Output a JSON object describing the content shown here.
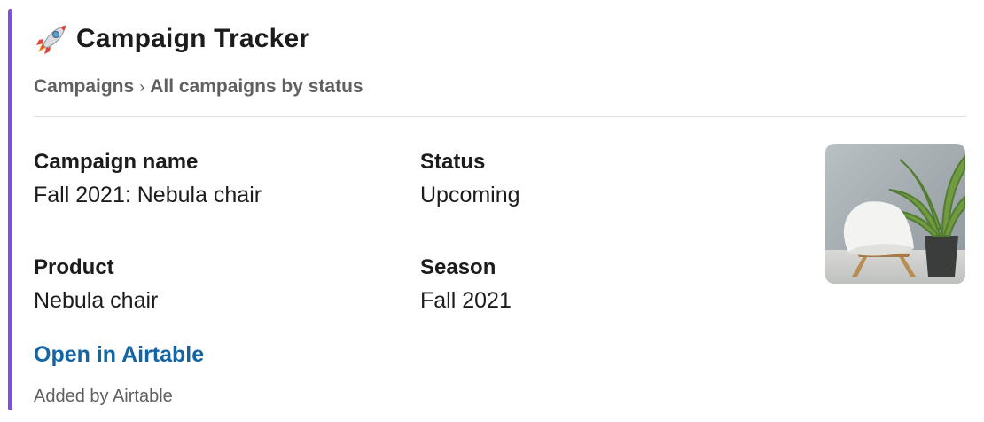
{
  "card": {
    "accent_color": "#7b4fe0",
    "icon": "rocket-icon",
    "title": "Campaign Tracker",
    "breadcrumb": {
      "parent": "Campaigns",
      "separator": "›",
      "current": "All campaigns by status"
    },
    "fields": {
      "campaign_name": {
        "label": "Campaign name",
        "value": "Fall 2021: Nebula chair"
      },
      "status": {
        "label": "Status",
        "value": "Upcoming"
      },
      "product": {
        "label": "Product",
        "value": "Nebula chair"
      },
      "season": {
        "label": "Season",
        "value": "Fall 2021"
      }
    },
    "thumbnail_icon": "chair-with-plant-photo",
    "open_link_label": "Open in Airtable",
    "link_color": "#1264a3",
    "footer": "Added by Airtable"
  }
}
